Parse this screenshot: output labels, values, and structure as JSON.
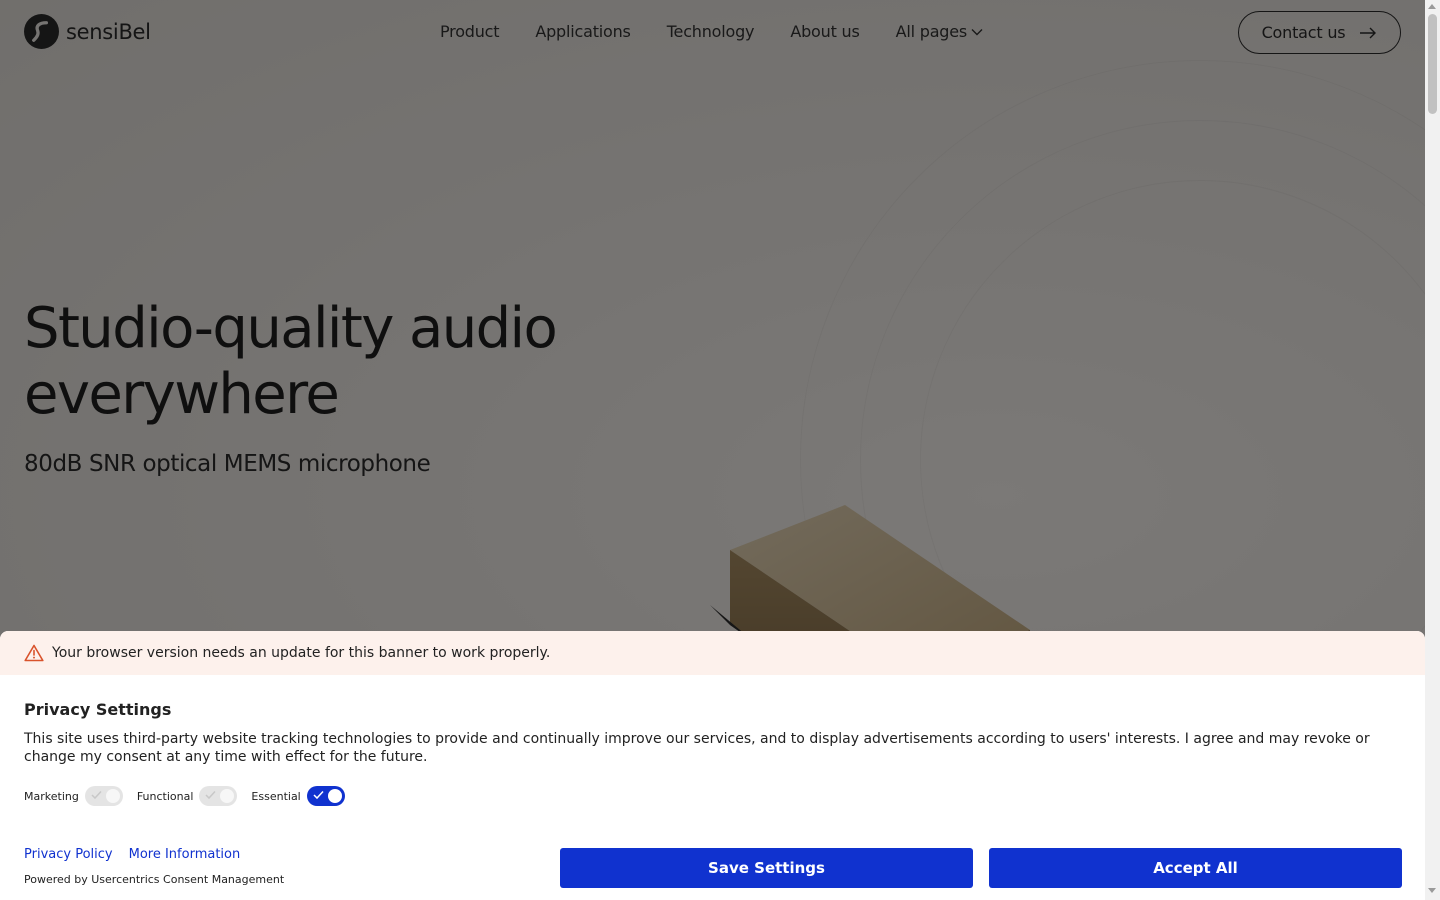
{
  "header": {
    "logo_text": "sensiBel",
    "nav": [
      "Product",
      "Applications",
      "Technology",
      "About us",
      "All pages"
    ],
    "contact_label": "Contact us"
  },
  "hero": {
    "title_line1": "Studio-quality audio",
    "title_line2": "everywhere",
    "subtitle": "80dB SNR optical MEMS microphone"
  },
  "banner": {
    "warning": "Your browser version needs an update for this banner to work properly.",
    "title": "Privacy Settings",
    "text": "This site uses third-party website tracking technologies to provide and continually improve our services, and to display advertisements according to users' interests. I agree and may revoke or change my consent at any time with effect for the future.",
    "toggles": [
      {
        "label": "Marketing",
        "on": false
      },
      {
        "label": "Functional",
        "on": false
      },
      {
        "label": "Essential",
        "on": true
      }
    ],
    "privacy_policy": "Privacy Policy",
    "more_info": "More Information",
    "powered": "Powered by Usercentrics Consent Management",
    "save_label": "Save Settings",
    "accept_label": "Accept All"
  },
  "colors": {
    "accent": "#1032cf",
    "warning_bg": "#fdf1ec",
    "warning_icon": "#d9532c"
  },
  "icons": [
    "logo-mark",
    "chevron-down-icon",
    "arrow-right-icon",
    "warning-icon",
    "check-icon"
  ]
}
